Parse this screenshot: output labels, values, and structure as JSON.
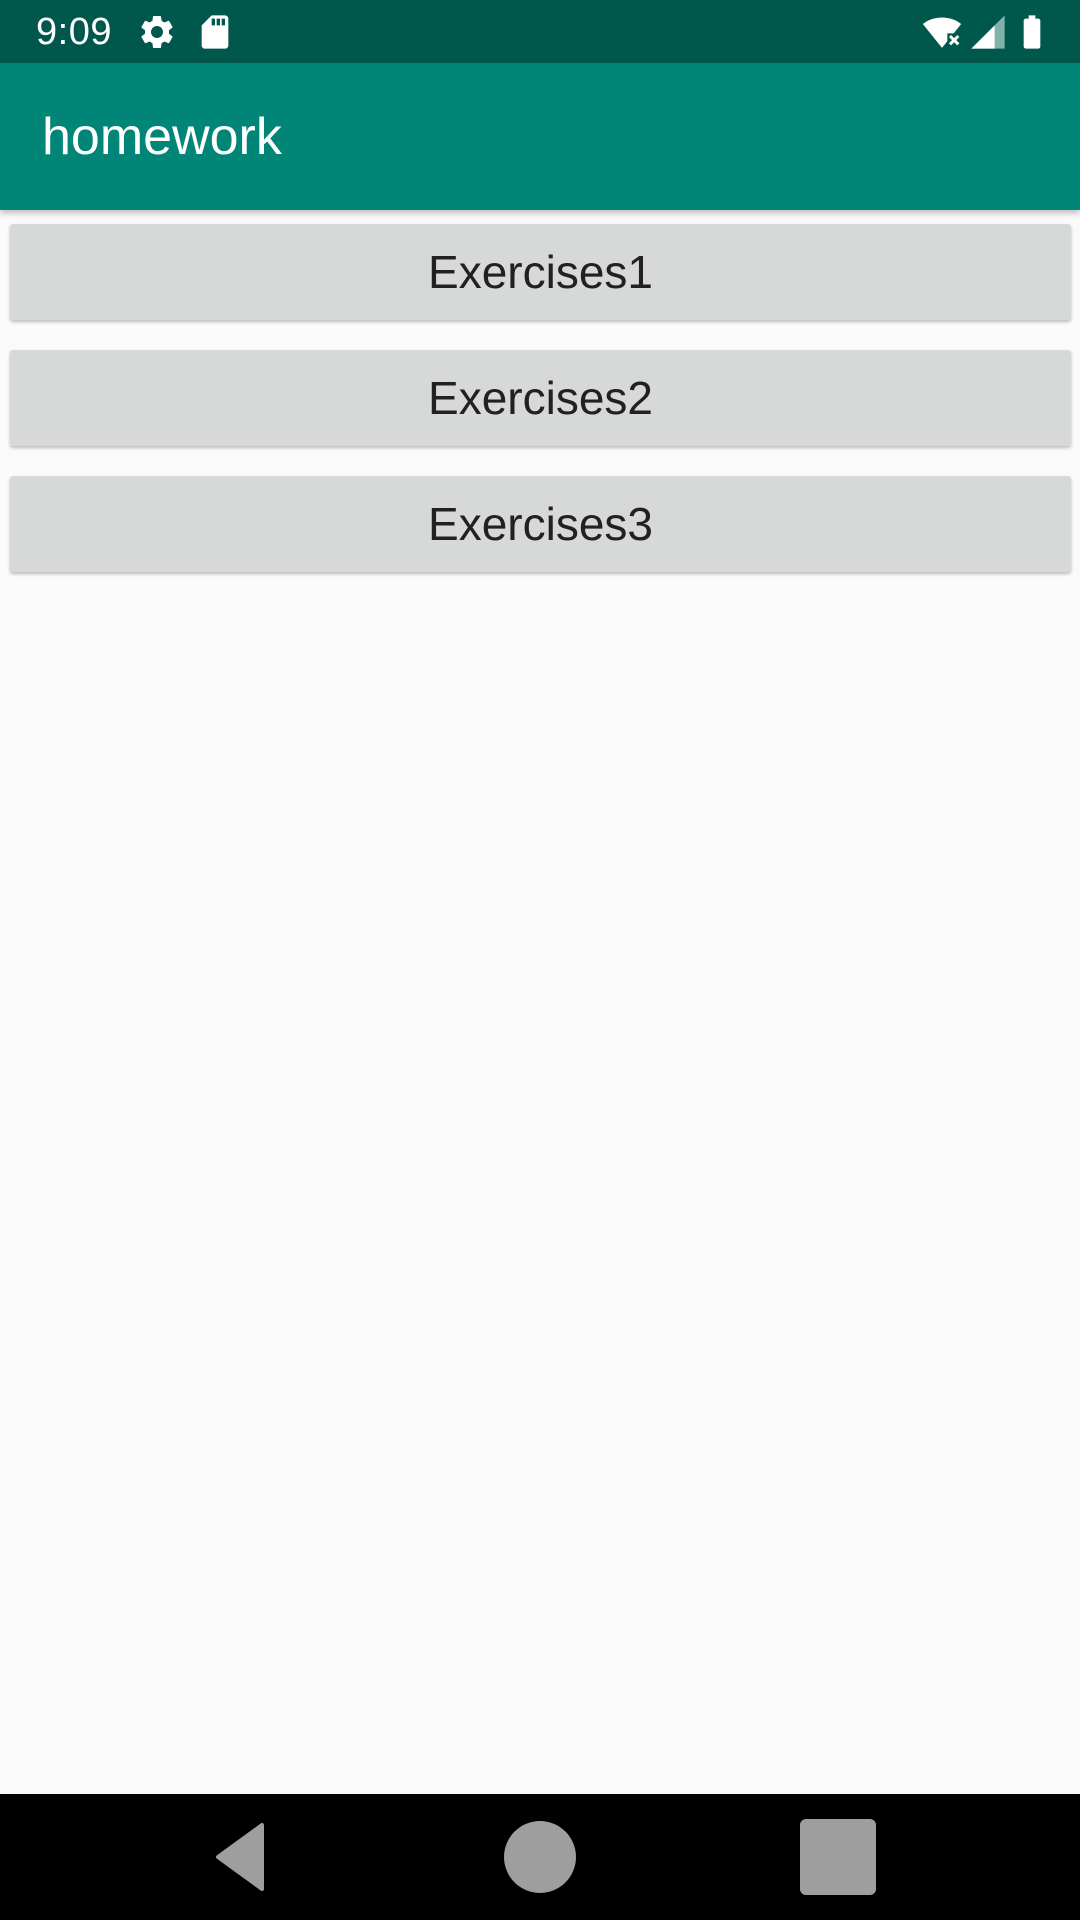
{
  "status_bar": {
    "time": "9:09",
    "icons": [
      "gear-icon",
      "sd-card-icon",
      "wifi-icon",
      "signal-icon",
      "battery-icon"
    ]
  },
  "app_bar": {
    "title": "homework"
  },
  "buttons": [
    {
      "label": "Exercises1"
    },
    {
      "label": "Exercises2"
    },
    {
      "label": "Exercises3"
    }
  ],
  "nav_bar": {
    "icons": [
      "back-icon",
      "home-icon",
      "recents-icon"
    ]
  },
  "colors": {
    "status_bar": "#00574b",
    "primary": "#008577",
    "button_bg": "#d7d8d8",
    "background": "#fafafa"
  }
}
